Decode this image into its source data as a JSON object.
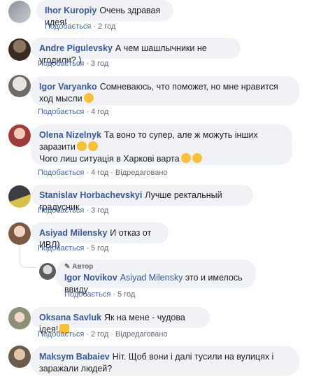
{
  "comments": [
    {
      "author": "Ihor Kuropiy",
      "text": "Очень здравая идея!",
      "like": "Подобається",
      "time": "2 год"
    },
    {
      "author": "Andre Pigulevsky",
      "text": "А чем шашлычники не угодили? )",
      "like": "Подобається",
      "time": "3 год"
    },
    {
      "author": "Igor Varyanko",
      "text": "Сомневаюсь, что поможет, но мне нравится ход мысли",
      "like": "Подобається",
      "time": "4 год"
    },
    {
      "author": "Olena Nizelnyk",
      "text": "Та воно то супер, але ж можуть інших заразити",
      "text2": "Чого лиш ситуація в Харкові варта",
      "like": "Подобається",
      "time": "4 год",
      "edited": "Відредаговано"
    },
    {
      "author": "Stanislav Horbachevskyi",
      "text": "Лучше ректальный градусник",
      "like": "Подобається",
      "time": "3 год"
    },
    {
      "author": "Asiyad Milensky",
      "text": "И отказ от ИВЛ)",
      "like": "Подобається",
      "time": "5 год"
    },
    {
      "author": "Oksana Savluk",
      "text": "Як на мене - чудова ідея!",
      "like": "Подобається",
      "time": "2 год",
      "edited": "Відредаговано"
    },
    {
      "author": "Maksym Babaiev",
      "text": "Ніт. Щоб вони і далі тусили на вулицях і заражали людей?",
      "like": "",
      "time": ""
    }
  ],
  "reply": {
    "badge": "Автор",
    "author": "Igor Novikov",
    "mention": "Asiyad Milensky",
    "text": "это и имелось ввиду",
    "like": "Подобається",
    "time": "5 год"
  },
  "colors": {
    "bubble": "#f0f2f5",
    "author": "#385898",
    "action": "#4267b2",
    "meta": "#65676b",
    "emoji": "#f7c23a"
  },
  "icons": {
    "smile": "slightly-smiling-face-emoji",
    "sad": "disappointed-face-emoji",
    "cry": "crying-face-emoji",
    "thumbs": "thumbs-up-emoji",
    "pencil": "pencil-icon"
  }
}
